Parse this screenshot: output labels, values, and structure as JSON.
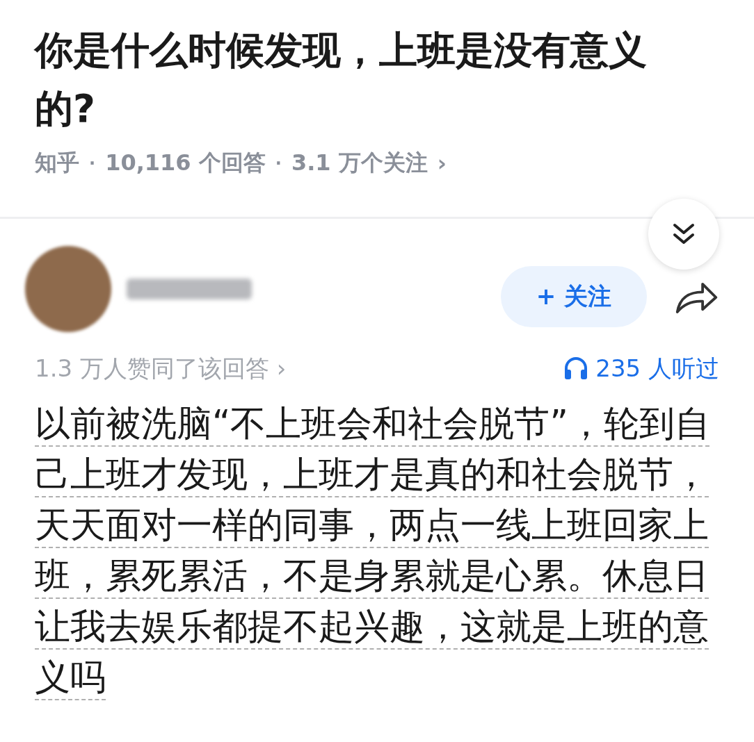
{
  "question": {
    "title": "你是什么时候发现，上班是没有意义的?",
    "source": "知乎",
    "separators": [
      "·",
      "·"
    ],
    "answers": "10,116 个回答",
    "followers": "3.1 万个关注",
    "chevron": "›"
  },
  "author": {
    "follow_button": "+ 关注"
  },
  "stats": {
    "upvotes": "1.3 万人赞同了该回答",
    "chevron": "›",
    "listens": "235 人听过"
  },
  "answer": {
    "text": "以前被洗脑“不上班会和社会脱节”，轮到自己上班才发现，上班才是真的和社会脱节，天天面对一样的同事，两点一线上班回家上班，累死累活，不是身累就是心累。休息日让我去娱乐都提不起兴趣，这就是上班的意义吗"
  }
}
